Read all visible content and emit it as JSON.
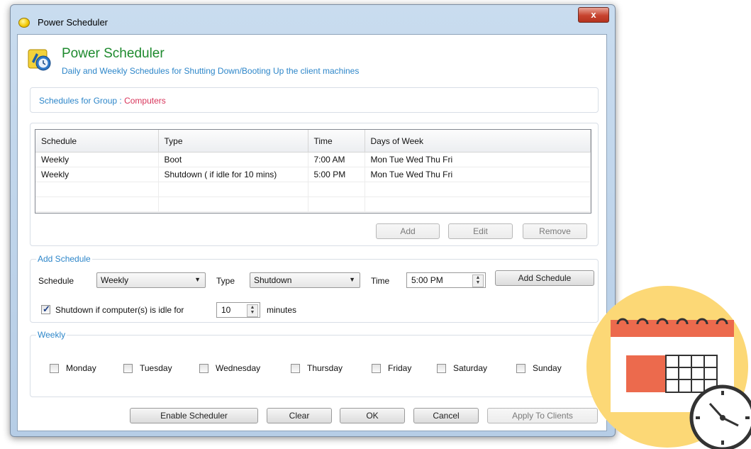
{
  "window": {
    "title": "Power Scheduler",
    "close_label": "x"
  },
  "header": {
    "title": "Power Scheduler",
    "subtitle": "Daily and Weekly Schedules for Shutting Down/Booting Up the client machines"
  },
  "group": {
    "label": "Schedules for Group :",
    "value": "Computers"
  },
  "table": {
    "columns": [
      "Schedule",
      "Type",
      "Time",
      "Days of Week"
    ],
    "rows": [
      [
        "Weekly",
        "Boot",
        "7:00 AM",
        "Mon Tue Wed Thu Fri"
      ],
      [
        "Weekly",
        "Shutdown ( if idle for 10 mins)",
        "5:00 PM",
        "Mon Tue Wed Thu Fri"
      ]
    ]
  },
  "list_buttons": {
    "add": "Add",
    "edit": "Edit",
    "remove": "Remove"
  },
  "add_schedule": {
    "legend": "Add Schedule",
    "schedule_label": "Schedule",
    "schedule_value": "Weekly",
    "type_label": "Type",
    "type_value": "Shutdown",
    "time_label": "Time",
    "time_value": "5:00 PM",
    "add_button": "Add Schedule",
    "idle_checkbox_label": "Shutdown if computer(s) is idle for",
    "idle_checked": true,
    "idle_value": "10",
    "idle_unit": "minutes"
  },
  "weekly": {
    "legend": "Weekly",
    "days": [
      "Monday",
      "Tuesday",
      "Wednesday",
      "Thursday",
      "Friday",
      "Saturday",
      "Sunday"
    ]
  },
  "footer_buttons": {
    "enable": "Enable Scheduler",
    "clear": "Clear",
    "ok": "OK",
    "cancel": "Cancel",
    "apply": "Apply To Clients"
  },
  "colors": {
    "accent_blue": "#2d86c9",
    "title_green": "#1e8a2e",
    "group_value_red": "#d8345a",
    "calendar_circle": "#fcd876",
    "calendar_red": "#ec6a4d"
  },
  "icons": {
    "title": "yellow-orb-icon",
    "header": "power-scheduler-app-icon",
    "decoration": "calendar-clock-icon"
  }
}
